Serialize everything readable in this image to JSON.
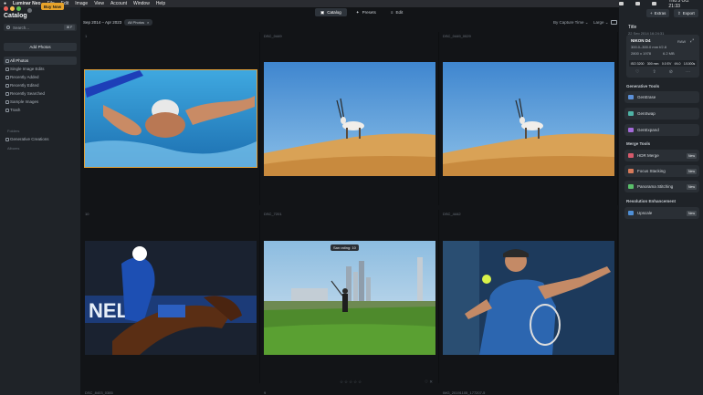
{
  "menubar": {
    "app": "Luminar Neo",
    "items": [
      "File",
      "Edit",
      "Image",
      "View",
      "Account",
      "Window",
      "Help"
    ],
    "clock": "Thu 5 Oct  21:33"
  },
  "left": {
    "buy_now": "Buy Now",
    "title": "Catalog",
    "search_placeholder": "Search...",
    "search_shortcut": "⌘ F",
    "add_photos": "Add Photos",
    "nav": [
      "All Photos",
      "Single Image Edits",
      "Recently Added",
      "Recently Edited",
      "Recently Searched",
      "Sample Images",
      "Trash"
    ],
    "folders_label": "Folders",
    "folder_item": "Generative Creations",
    "albums_label": "Albums"
  },
  "toolbar": {
    "tabs": [
      "Catalog",
      "Presets",
      "Edit"
    ],
    "date_range": "Sep 2014 – Apr 2023",
    "all_photos_pill": "All Photos",
    "sort": "By Capture Time",
    "size": "Large"
  },
  "grid": {
    "filenames": [
      "1",
      "DSC_0449",
      "DSC_0449_0029",
      "10",
      "DSC_7201",
      "DSC_4442",
      "DSC_8403_0385",
      "9",
      "IMG_20191105_177207-5"
    ],
    "tooltip": "San rating: 10",
    "stars": "☆☆☆☆☆"
  },
  "right": {
    "extras": "Extras",
    "export": "Export",
    "file_title": "Title",
    "date": "22 Sep 2014 16:24:31",
    "camera": "NIKON D4",
    "lens": "300.0–300.0 mm f/2.8",
    "dimensions": "2800 x 1978",
    "filesize": "6.2 MB",
    "format": "RAW",
    "exif": [
      "ISO 3200",
      "300 mm",
      "0.0 EV",
      "f/4.0",
      "1/1000s"
    ],
    "sections": [
      "Generative Tools",
      "Merge Tools",
      "Resolution Enhancement"
    ],
    "gen_tools": [
      "GenErase",
      "GenSwap",
      "GenExpand"
    ],
    "merge_tools": [
      "HDR Merge",
      "Focus Stacking",
      "Panorama Stitching"
    ],
    "res_tools": [
      "Upscale"
    ],
    "new_badge": "New"
  }
}
